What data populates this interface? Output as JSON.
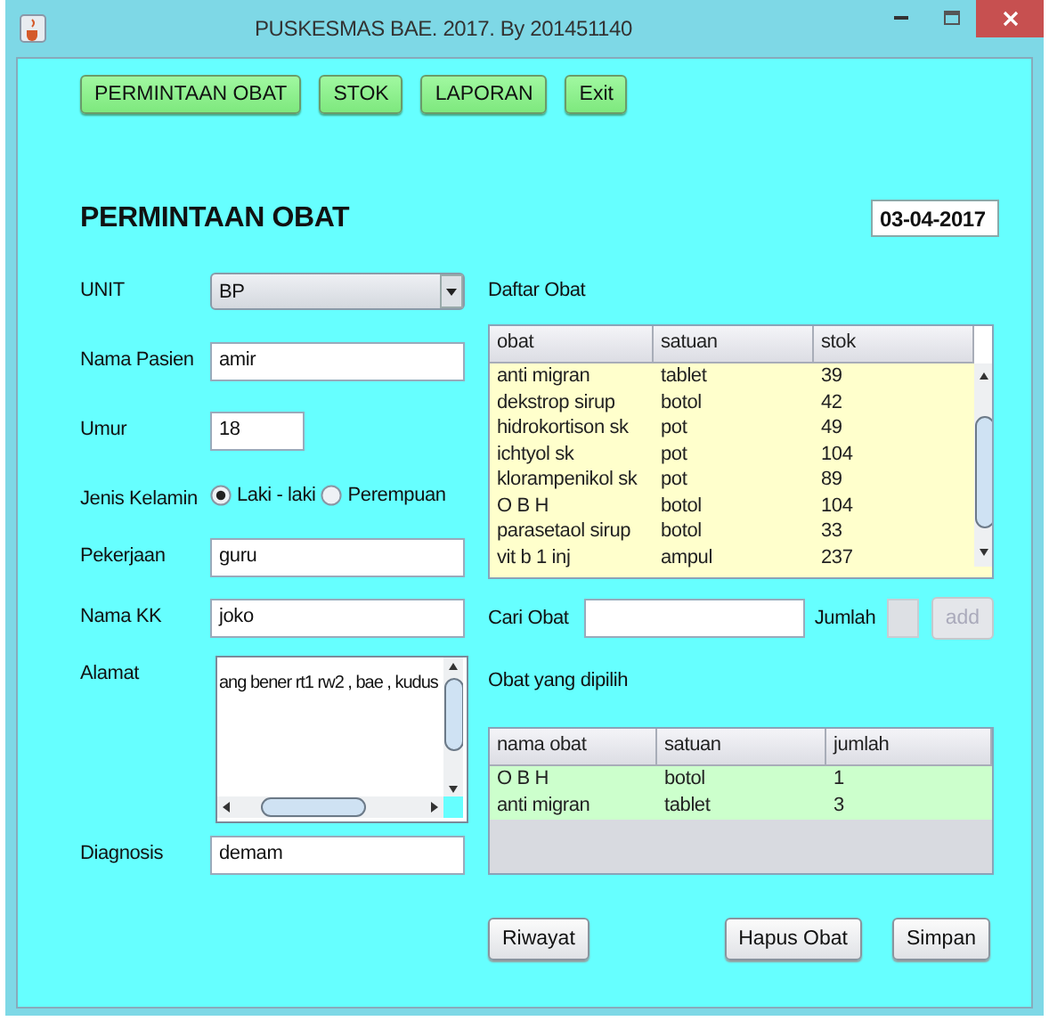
{
  "window": {
    "title": "PUSKESMAS BAE. 2017. By 201451140"
  },
  "menu_buttons": [
    "PERMINTAAN OBAT",
    "STOK",
    "LAPORAN",
    "Exit"
  ],
  "heading": "PERMINTAAN OBAT",
  "date": "03-04-2017",
  "fields": [
    {
      "kind": "combo",
      "label": "UNIT",
      "value": "BP"
    },
    {
      "kind": "text",
      "label": "Nama Pasien",
      "value": "amir"
    },
    {
      "kind": "number",
      "label": "Umur",
      "value": "18"
    },
    {
      "kind": "radio",
      "label": "Jenis Kelamin",
      "options": [
        {
          "label": "Laki - laki",
          "selected": true
        },
        {
          "label": "Perempuan",
          "selected": false
        }
      ]
    },
    {
      "kind": "text",
      "label": "Pekerjaan",
      "value": "guru"
    },
    {
      "kind": "text",
      "label": "Nama KK",
      "value": "joko"
    },
    {
      "kind": "textarea",
      "label": "Alamat",
      "value": "ang bener rt1 rw2 , bae , kudus"
    },
    {
      "kind": "text",
      "label": "Diagnosis",
      "value": "demam"
    }
  ],
  "daftar_obat": {
    "label": "Daftar Obat",
    "columns": [
      "obat",
      "satuan",
      "stok"
    ],
    "rows": [
      [
        "anti migran",
        "tablet",
        "39"
      ],
      [
        "dekstrop sirup",
        "botol",
        "42"
      ],
      [
        "hidrokortison sk",
        "pot",
        "49"
      ],
      [
        "ichtyol sk",
        "pot",
        "104"
      ],
      [
        "klorampenikol sk",
        "pot",
        "89"
      ],
      [
        "O B H",
        "botol",
        "104"
      ],
      [
        "parasetaol sirup",
        "botol",
        "33"
      ],
      [
        "vit b 1 inj",
        "ampul",
        "237"
      ]
    ]
  },
  "search": {
    "label": "Cari Obat",
    "jumlah_label": "Jumlah",
    "jumlah_disabled": true,
    "add_label": "add",
    "add_disabled": true
  },
  "obat_dipilih": {
    "label": "Obat yang dipilih",
    "columns": [
      "nama obat",
      "satuan",
      "jumlah"
    ],
    "rows": [
      [
        "O B H",
        "botol",
        "1"
      ],
      [
        "anti migran",
        "tablet",
        "3"
      ]
    ]
  },
  "actions": [
    "Riwayat",
    "Hapus Obat",
    "Simpan"
  ]
}
